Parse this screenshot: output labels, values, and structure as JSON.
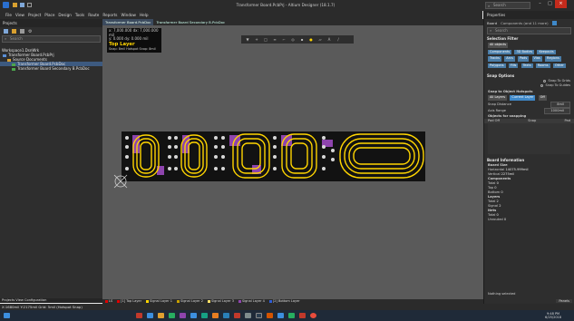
{
  "app": {
    "window_title": "Transformer Board.PcbPrj - Altium Designer (18.1.7)",
    "search_placeholder": "Search"
  },
  "menu": [
    "File",
    "View",
    "Project",
    "Place",
    "Design",
    "Tools",
    "Route",
    "Reports",
    "Window",
    "Help"
  ],
  "left_panel": {
    "title": "Projects",
    "search_placeholder": "Search",
    "tree": [
      {
        "label": "Workspace1.DsnWrk",
        "level": 0,
        "selected": false
      },
      {
        "label": "Transformer Board.PcbPrj",
        "level": 0,
        "selected": false
      },
      {
        "label": "Source Documents",
        "level": 1,
        "selected": false
      },
      {
        "label": "Transformer Board.PcbDoc",
        "level": 2,
        "selected": true
      },
      {
        "label": "Transformer Board Secondary B.PcbDoc",
        "level": 2,
        "selected": false
      }
    ],
    "footer": "Projects   View Configuration"
  },
  "tabs": [
    {
      "label": "Transformer Board.PcbDoc",
      "active": true
    },
    {
      "label": "Transformer Board Secondary B.PcbDoc",
      "active": false
    }
  ],
  "info_overlay": {
    "line1": "x:  7,000.000  dx:  7,000.000 mil",
    "line2": "y:    0.000      dy:   0.000  mil",
    "layer": "Top Layer",
    "snap": "Snap: 8mil Hotspot Snap: 8mil"
  },
  "layers": [
    {
      "name": "LS",
      "color": "#e00000"
    },
    {
      "name": "[1] Top Layer",
      "color": "#e00000"
    },
    {
      "name": "Signal Layer 1",
      "color": "#ffd500"
    },
    {
      "name": "Signal Layer 2",
      "color": "#c8a000"
    },
    {
      "name": "Signal Layer 3",
      "color": "#ffe066"
    },
    {
      "name": "Signal Layer 4",
      "color": "#8e44ad"
    },
    {
      "name": "[2] Bottom Layer",
      "color": "#2e5cd6"
    }
  ],
  "properties": {
    "title": "Properties",
    "board_label": "Board",
    "components_label": "Components (and 11 more)",
    "search_placeholder": "Search",
    "selection_filter": {
      "title": "Selection Filter",
      "all_objects": "All objects",
      "chips": [
        "Components",
        "3D Bodies",
        "Keepouts",
        "Tracks",
        "Arcs",
        "Pads",
        "Vias",
        "Regions",
        "Polygons",
        "Fills",
        "Texts",
        "Rooms",
        "Other"
      ]
    },
    "snap_options": {
      "title": "Snap Options",
      "opt1": "Snap To Grids",
      "opt2": "Snap To Guides",
      "snap_to_object": "Snap to Object Hotspots",
      "all_layers": "All Layers",
      "current_layer": "Current Layer",
      "off": "Off",
      "snap_distance_label": "Snap Distance",
      "snap_distance_value": "8mil",
      "axis_range_label": "Axis Range",
      "axis_range_value": "1000mil",
      "objects_for_snapping": "Objects for snapping",
      "col1": "Pad Off",
      "col2": "Snap",
      "col3": "Pad"
    },
    "board_info": {
      "title": "Board Information",
      "board_size_label": "Board Size",
      "horizontal_label": "Horizontal",
      "horizontal_value": "14075.999mil",
      "vertical_label": "Vertical",
      "vertical_value": "2275mil",
      "components_label": "Components",
      "total_label": "Total",
      "total_value": "0",
      "top_label": "Top",
      "top_value": "0",
      "bottom_label": "Bottom",
      "bottom_value": "0",
      "layers_label": "Layers",
      "layers_total": "2",
      "layers_signal": "2",
      "nets_label": "Nets",
      "nets_total": "0",
      "nets_unrouted": "0",
      "nothing_selected": "Nothing selected"
    },
    "panels_btn": "Panels"
  },
  "status": {
    "left": "X:1680mil Y:2175mil   Grid: 5mil   (Hotspot Snap)",
    "time": "9:48 PM",
    "date": "6/25/2018"
  },
  "colors": {
    "board": "#111111",
    "copper": "#ffd500",
    "keepout": "#8e44ad",
    "pad": "#d0d0d0"
  }
}
